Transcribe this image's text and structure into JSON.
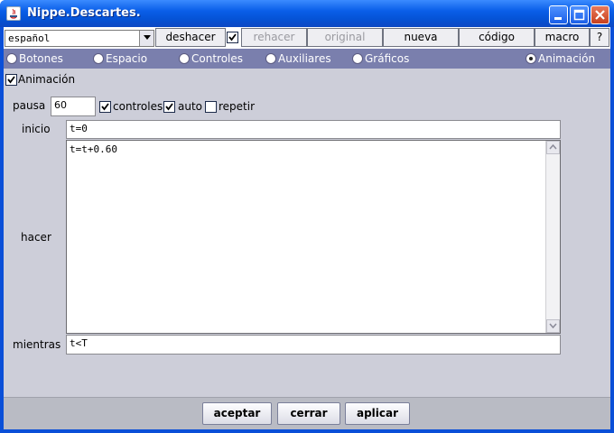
{
  "window": {
    "title": "Nippe.Descartes."
  },
  "toolbar": {
    "language": "español",
    "buttons": [
      "deshacer",
      "rehacer",
      "original",
      "nueva",
      "código",
      "macro",
      "?"
    ]
  },
  "tabs": [
    {
      "label": "Botones",
      "selected": false
    },
    {
      "label": "Espacio",
      "selected": false
    },
    {
      "label": "Controles",
      "selected": false
    },
    {
      "label": "Auxiliares",
      "selected": false
    },
    {
      "label": "Gráficos",
      "selected": false
    },
    {
      "label": "Animación",
      "selected": true
    }
  ],
  "animation": {
    "enable_label": "Animación",
    "pausa_label": "pausa",
    "pausa_value": "60",
    "controles_label": "controles",
    "auto_label": "auto",
    "repetir_label": "repetir",
    "inicio_label": "inicio",
    "inicio_value": "t=0",
    "hacer_label": "hacer",
    "hacer_value": "t=t+0.60",
    "mientras_label": "mientras",
    "mientras_value": "t<T"
  },
  "buttons": {
    "accept": "aceptar",
    "close": "cerrar",
    "apply": "aplicar"
  }
}
